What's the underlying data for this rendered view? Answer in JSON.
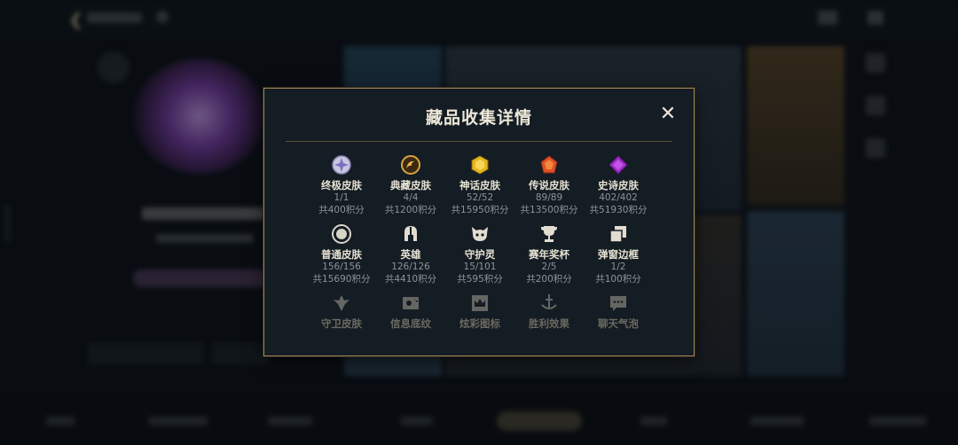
{
  "modal": {
    "title": "藏品收集详情",
    "close_symbol": "✕"
  },
  "categories": [
    {
      "name": "终极皮肤",
      "count": "1/1",
      "points": "共400积分",
      "icon": "ultimate-skin-icon"
    },
    {
      "name": "典藏皮肤",
      "count": "4/4",
      "points": "共1200积分",
      "icon": "legacy-skin-icon"
    },
    {
      "name": "神话皮肤",
      "count": "52/52",
      "points": "共15950积分",
      "icon": "mythic-skin-icon"
    },
    {
      "name": "传说皮肤",
      "count": "89/89",
      "points": "共13500积分",
      "icon": "legendary-skin-icon"
    },
    {
      "name": "史诗皮肤",
      "count": "402/402",
      "points": "共51930积分",
      "icon": "epic-skin-icon"
    },
    {
      "name": "普通皮肤",
      "count": "156/156",
      "points": "共15690积分",
      "icon": "standard-skin-icon"
    },
    {
      "name": "英雄",
      "count": "126/126",
      "points": "共4410积分",
      "icon": "champion-helmet-icon"
    },
    {
      "name": "守护灵",
      "count": "15/101",
      "points": "共595积分",
      "icon": "companion-icon"
    },
    {
      "name": "赛年奖杯",
      "count": "2/5",
      "points": "共200积分",
      "icon": "trophy-icon"
    },
    {
      "name": "弹窗边框",
      "count": "1/2",
      "points": "共100积分",
      "icon": "frame-icon"
    }
  ],
  "faded_categories": [
    {
      "name": "守卫皮肤",
      "icon": "ward-skin-icon"
    },
    {
      "name": "信息底纹",
      "icon": "banner-icon"
    },
    {
      "name": "炫彩图标",
      "icon": "crown-icon"
    },
    {
      "name": "胜利效果",
      "icon": "finisher-icon"
    },
    {
      "name": "聊天气泡",
      "icon": "chat-bubble-icon"
    }
  ],
  "colors": {
    "modal_border": "#a0875a",
    "modal_bg": "#141c24",
    "title": "#ece7d8",
    "muted": "#8f9399"
  }
}
